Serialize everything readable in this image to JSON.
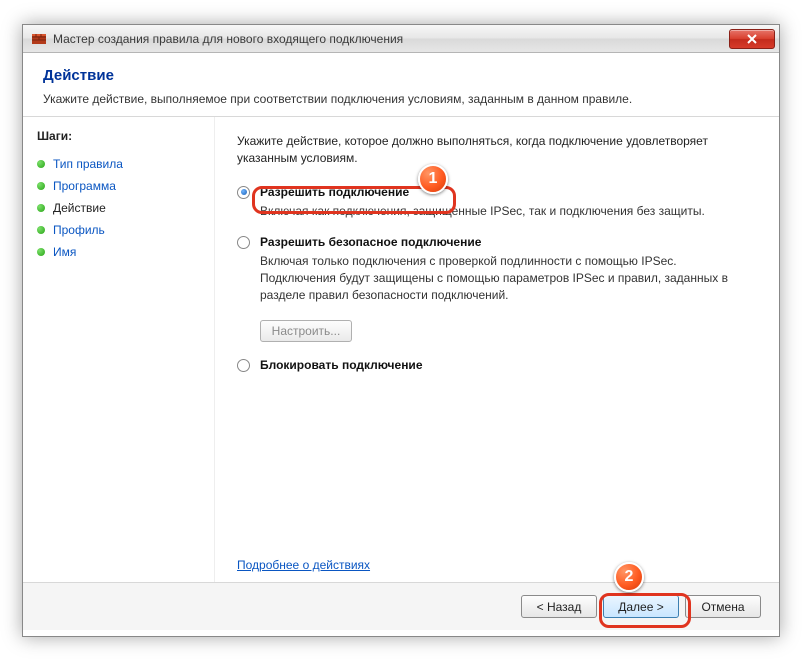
{
  "window": {
    "title": "Мастер создания правила для нового входящего подключения"
  },
  "header": {
    "title": "Действие",
    "subtitle": "Укажите действие, выполняемое при соответствии подключения условиям, заданным в данном правиле."
  },
  "sidebar": {
    "heading": "Шаги:",
    "steps": [
      {
        "label": "Тип правила",
        "current": false
      },
      {
        "label": "Программа",
        "current": false
      },
      {
        "label": "Действие",
        "current": true
      },
      {
        "label": "Профиль",
        "current": false
      },
      {
        "label": "Имя",
        "current": false
      }
    ]
  },
  "content": {
    "intro_line1": "Укажите действие, которое должно выполняться, когда подключение удовлетворяет",
    "intro_line2": "указанным условиям.",
    "options": [
      {
        "label": "Разрешить подключение",
        "desc": "Включая как подключения, защищенные IPSec, так и подключения без защиты.",
        "checked": true
      },
      {
        "label": "Разрешить безопасное подключение",
        "desc": "Включая только подключения с проверкой подлинности с помощью IPSec. Подключения будут защищены с помощью параметров IPSec и правил, заданных в разделе правил безопасности подключений.",
        "checked": false,
        "customize": "Настроить..."
      },
      {
        "label": "Блокировать подключение",
        "desc": "",
        "checked": false
      }
    ],
    "help_link": "Подробнее о действиях"
  },
  "footer": {
    "back": "< Назад",
    "next": "Далее >",
    "cancel": "Отмена"
  },
  "annotations": {
    "badge1": "1",
    "badge2": "2"
  }
}
